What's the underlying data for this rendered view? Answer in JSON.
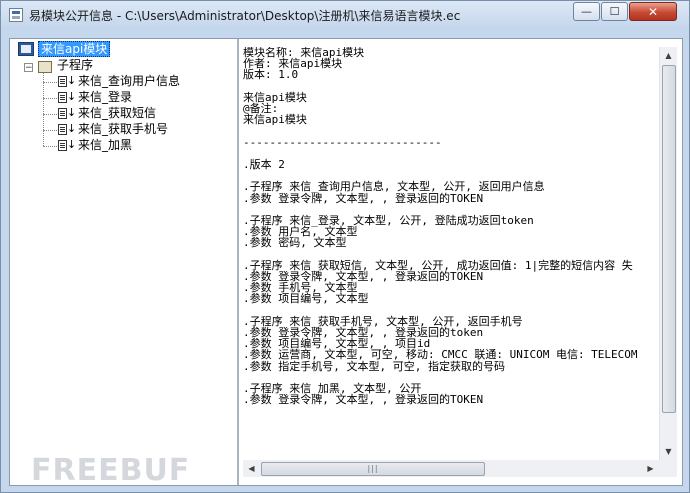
{
  "window": {
    "title": "易模块公开信息 - C:\\Users\\Administrator\\Desktop\\注册机\\来信易语言模块.ec",
    "controls": {
      "minimize": "—",
      "maximize": "☐",
      "close": "✕"
    }
  },
  "tree": {
    "root_label": "来信api模块",
    "group_label": "子程序",
    "items": [
      "来信_查询用户信息",
      "来信_登录",
      "来信_获取短信",
      "来信_获取手机号",
      "来信_加黑"
    ]
  },
  "content": {
    "lines": [
      "模块名称: 来信api模块",
      "作者: 来信api模块",
      "版本: 1.0",
      "",
      "来信api模块",
      "@备注:",
      "来信api模块",
      "",
      "------------------------------",
      "",
      ".版本 2",
      "",
      ".子程序 来信_查询用户信息, 文本型, 公开, 返回用户信息",
      ".参数 登录令牌, 文本型, , 登录返回的TOKEN",
      "",
      ".子程序 来信_登录, 文本型, 公开, 登陆成功返回token",
      ".参数 用户名, 文本型",
      ".参数 密码, 文本型",
      "",
      ".子程序 来信_获取短信, 文本型, 公开, 成功返回值: 1|完整的短信内容 失",
      ".参数 登录令牌, 文本型, , 登录返回的TOKEN",
      ".参数 手机号, 文本型",
      ".参数 项目编号, 文本型",
      "",
      ".子程序 来信_获取手机号, 文本型, 公开, 返回手机号",
      ".参数 登录令牌, 文本型, , 登录返回的token",
      ".参数 项目编号, 文本型, , 项目id",
      ".参数 运营商, 文本型, 可空, 移动: CMCC 联通: UNICOM 电信: TELECOM",
      ".参数 指定手机号, 文本型, 可空, 指定获取的号码",
      "",
      ".子程序 来信_加黑, 文本型, 公开",
      ".参数 登录令牌, 文本型, , 登录返回的TOKEN"
    ]
  },
  "scrollbar": {
    "up": "▲",
    "down": "▼",
    "left": "◀",
    "right": "▶",
    "grip": "|||"
  },
  "watermark": "FREEBUF"
}
